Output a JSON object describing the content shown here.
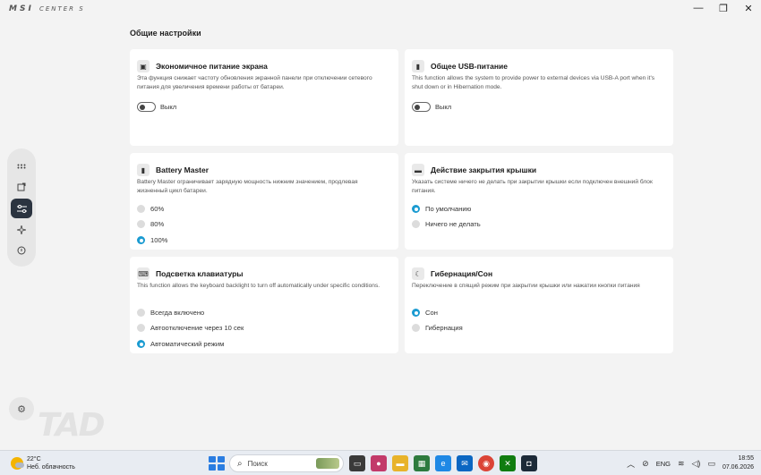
{
  "window": {
    "logo": "MSI",
    "logo_sub": "CENTER S",
    "controls": [
      "—",
      "❐",
      "✕"
    ]
  },
  "section_title": "Общие настройки",
  "cards": {
    "eco_power": {
      "title": "Экономичное питание экрана",
      "desc": "Эта функция снижает частоту обновления экранной панели при отключении сетевого питания для увеличения времени работы от батареи.",
      "toggle_label": "Выкл",
      "toggle_on": false
    },
    "usb_power": {
      "title": "Общее USB-питание",
      "desc": "This function allows the system to provide power to external devices via USB-A port when it's shut down or in Hibernation mode.",
      "toggle_label": "Выкл",
      "toggle_on": false
    },
    "battery": {
      "title": "Battery Master",
      "desc": "Battery Master ограничивает зарядную мощность нижним значением, продлевая жизненный цикл батареи.",
      "options": [
        "60%",
        "80%",
        "100%"
      ],
      "selected": "100%"
    },
    "lid": {
      "title": "Действие закрытия крышки",
      "desc": "Указать системе ничего не делать при закрытии крышки если подключен внешний блок питания.",
      "options": [
        "По умолчанию",
        "Ничего не делать"
      ],
      "selected": "По умолчанию"
    },
    "backlight": {
      "title": "Подсветка клавиатуры",
      "desc": "This function allows the keyboard backlight to turn off automatically under specific conditions.",
      "options": [
        "Всегда включено",
        "Автоотключение через 10 сек",
        "Автоматический режим"
      ],
      "selected": "Автоматический режим"
    },
    "hibernate": {
      "title": "Гибернация/Сон",
      "desc": "Переключение в спящий режим при закрытии крышки или нажатии кнопки питания",
      "options": [
        "Сон",
        "Гибернация"
      ],
      "selected": "Сон"
    }
  },
  "taskbar": {
    "temperature": "22°C",
    "weather": "Неб. облачность",
    "search_placeholder": "Поиск",
    "language": "ENG",
    "time": "18:55",
    "date": "07.06.2026"
  },
  "colors": {
    "accent": "#1b9bd1",
    "rail_active": "#2b3440",
    "background": "#f3f3f3"
  }
}
